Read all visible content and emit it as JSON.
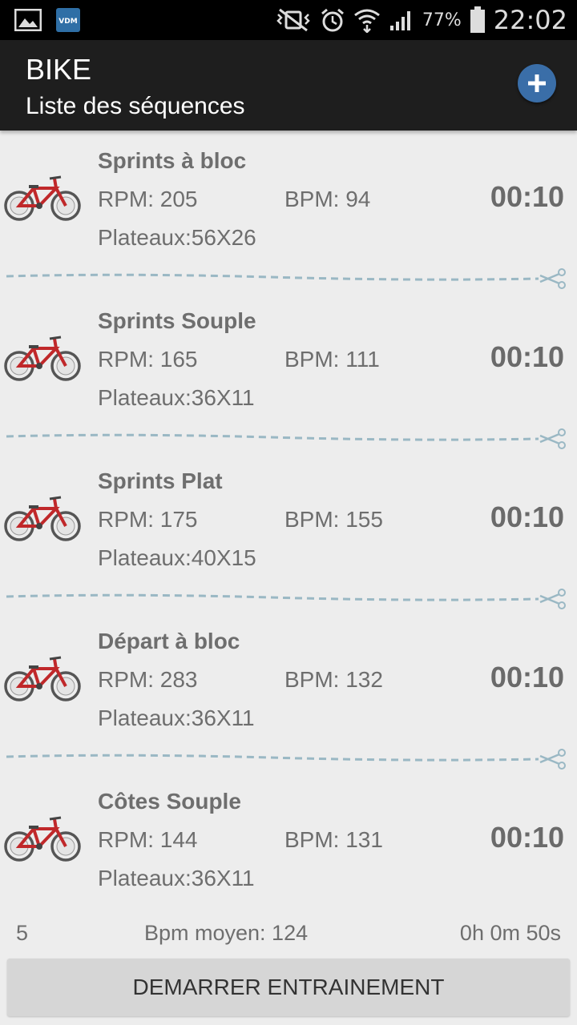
{
  "status_bar": {
    "battery": "77%",
    "time": "22:02",
    "left_icons": [
      "gallery-icon",
      "vdm-app-icon"
    ],
    "right_icons": [
      "vibrate-mute-icon",
      "alarm-icon",
      "wifi-icon",
      "signal-icon",
      "battery-icon"
    ]
  },
  "app_bar": {
    "title": "BIKE",
    "subtitle": "Liste des séquences",
    "add_icon": "plus-icon",
    "accent_color": "#3a6ea8"
  },
  "sequences": [
    {
      "name": "Sprints à bloc",
      "rpm": "RPM: 205",
      "bpm": "BPM: 94",
      "plateaux": "Plateaux:56X26",
      "duration": "00:10"
    },
    {
      "name": "Sprints Souple",
      "rpm": "RPM: 165",
      "bpm": "BPM: 111",
      "plateaux": "Plateaux:36X11",
      "duration": "00:10"
    },
    {
      "name": "Sprints Plat",
      "rpm": "RPM: 175",
      "bpm": "BPM: 155",
      "plateaux": "Plateaux:40X15",
      "duration": "00:10"
    },
    {
      "name": "Départ à bloc",
      "rpm": "RPM: 283",
      "bpm": "BPM: 132",
      "plateaux": "Plateaux:36X11",
      "duration": "00:10"
    },
    {
      "name": "Côtes Souple",
      "rpm": "RPM: 144",
      "bpm": "BPM: 131",
      "plateaux": "Plateaux:36X11",
      "duration": "00:10"
    }
  ],
  "footer": {
    "count": "5",
    "avg_bpm": "Bpm moyen: 124",
    "total_time": "0h 0m 50s"
  },
  "start_button": "DEMARRER ENTRAINEMENT",
  "colors": {
    "bike_red": "#c0282a",
    "cutline": "#9ab8c4",
    "background": "#ededed"
  }
}
